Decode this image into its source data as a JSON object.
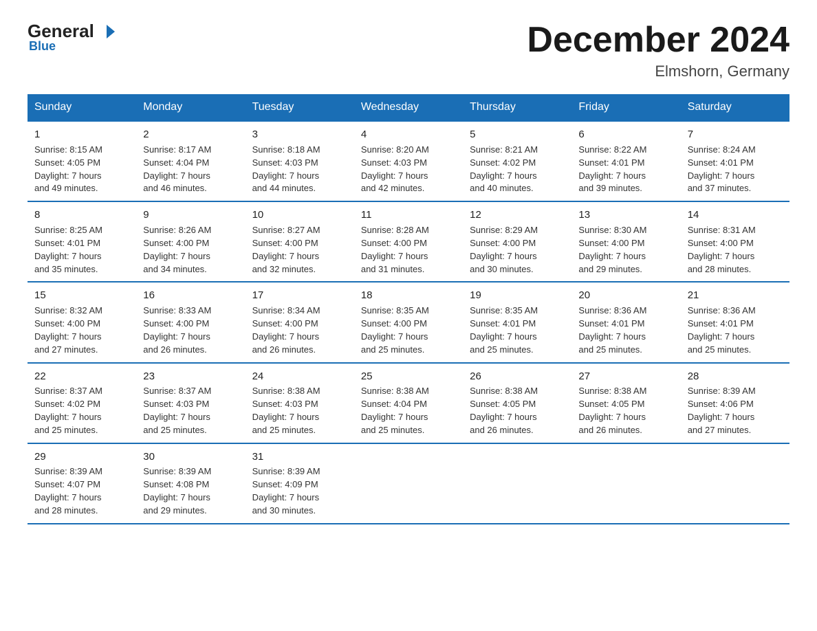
{
  "logo": {
    "general": "General",
    "blue": "Blue",
    "arrow": "▶"
  },
  "title": "December 2024",
  "subtitle": "Elmshorn, Germany",
  "headers": [
    "Sunday",
    "Monday",
    "Tuesday",
    "Wednesday",
    "Thursday",
    "Friday",
    "Saturday"
  ],
  "weeks": [
    [
      {
        "day": "1",
        "info": "Sunrise: 8:15 AM\nSunset: 4:05 PM\nDaylight: 7 hours\nand 49 minutes."
      },
      {
        "day": "2",
        "info": "Sunrise: 8:17 AM\nSunset: 4:04 PM\nDaylight: 7 hours\nand 46 minutes."
      },
      {
        "day": "3",
        "info": "Sunrise: 8:18 AM\nSunset: 4:03 PM\nDaylight: 7 hours\nand 44 minutes."
      },
      {
        "day": "4",
        "info": "Sunrise: 8:20 AM\nSunset: 4:03 PM\nDaylight: 7 hours\nand 42 minutes."
      },
      {
        "day": "5",
        "info": "Sunrise: 8:21 AM\nSunset: 4:02 PM\nDaylight: 7 hours\nand 40 minutes."
      },
      {
        "day": "6",
        "info": "Sunrise: 8:22 AM\nSunset: 4:01 PM\nDaylight: 7 hours\nand 39 minutes."
      },
      {
        "day": "7",
        "info": "Sunrise: 8:24 AM\nSunset: 4:01 PM\nDaylight: 7 hours\nand 37 minutes."
      }
    ],
    [
      {
        "day": "8",
        "info": "Sunrise: 8:25 AM\nSunset: 4:01 PM\nDaylight: 7 hours\nand 35 minutes."
      },
      {
        "day": "9",
        "info": "Sunrise: 8:26 AM\nSunset: 4:00 PM\nDaylight: 7 hours\nand 34 minutes."
      },
      {
        "day": "10",
        "info": "Sunrise: 8:27 AM\nSunset: 4:00 PM\nDaylight: 7 hours\nand 32 minutes."
      },
      {
        "day": "11",
        "info": "Sunrise: 8:28 AM\nSunset: 4:00 PM\nDaylight: 7 hours\nand 31 minutes."
      },
      {
        "day": "12",
        "info": "Sunrise: 8:29 AM\nSunset: 4:00 PM\nDaylight: 7 hours\nand 30 minutes."
      },
      {
        "day": "13",
        "info": "Sunrise: 8:30 AM\nSunset: 4:00 PM\nDaylight: 7 hours\nand 29 minutes."
      },
      {
        "day": "14",
        "info": "Sunrise: 8:31 AM\nSunset: 4:00 PM\nDaylight: 7 hours\nand 28 minutes."
      }
    ],
    [
      {
        "day": "15",
        "info": "Sunrise: 8:32 AM\nSunset: 4:00 PM\nDaylight: 7 hours\nand 27 minutes."
      },
      {
        "day": "16",
        "info": "Sunrise: 8:33 AM\nSunset: 4:00 PM\nDaylight: 7 hours\nand 26 minutes."
      },
      {
        "day": "17",
        "info": "Sunrise: 8:34 AM\nSunset: 4:00 PM\nDaylight: 7 hours\nand 26 minutes."
      },
      {
        "day": "18",
        "info": "Sunrise: 8:35 AM\nSunset: 4:00 PM\nDaylight: 7 hours\nand 25 minutes."
      },
      {
        "day": "19",
        "info": "Sunrise: 8:35 AM\nSunset: 4:01 PM\nDaylight: 7 hours\nand 25 minutes."
      },
      {
        "day": "20",
        "info": "Sunrise: 8:36 AM\nSunset: 4:01 PM\nDaylight: 7 hours\nand 25 minutes."
      },
      {
        "day": "21",
        "info": "Sunrise: 8:36 AM\nSunset: 4:01 PM\nDaylight: 7 hours\nand 25 minutes."
      }
    ],
    [
      {
        "day": "22",
        "info": "Sunrise: 8:37 AM\nSunset: 4:02 PM\nDaylight: 7 hours\nand 25 minutes."
      },
      {
        "day": "23",
        "info": "Sunrise: 8:37 AM\nSunset: 4:03 PM\nDaylight: 7 hours\nand 25 minutes."
      },
      {
        "day": "24",
        "info": "Sunrise: 8:38 AM\nSunset: 4:03 PM\nDaylight: 7 hours\nand 25 minutes."
      },
      {
        "day": "25",
        "info": "Sunrise: 8:38 AM\nSunset: 4:04 PM\nDaylight: 7 hours\nand 25 minutes."
      },
      {
        "day": "26",
        "info": "Sunrise: 8:38 AM\nSunset: 4:05 PM\nDaylight: 7 hours\nand 26 minutes."
      },
      {
        "day": "27",
        "info": "Sunrise: 8:38 AM\nSunset: 4:05 PM\nDaylight: 7 hours\nand 26 minutes."
      },
      {
        "day": "28",
        "info": "Sunrise: 8:39 AM\nSunset: 4:06 PM\nDaylight: 7 hours\nand 27 minutes."
      }
    ],
    [
      {
        "day": "29",
        "info": "Sunrise: 8:39 AM\nSunset: 4:07 PM\nDaylight: 7 hours\nand 28 minutes."
      },
      {
        "day": "30",
        "info": "Sunrise: 8:39 AM\nSunset: 4:08 PM\nDaylight: 7 hours\nand 29 minutes."
      },
      {
        "day": "31",
        "info": "Sunrise: 8:39 AM\nSunset: 4:09 PM\nDaylight: 7 hours\nand 30 minutes."
      },
      null,
      null,
      null,
      null
    ]
  ]
}
